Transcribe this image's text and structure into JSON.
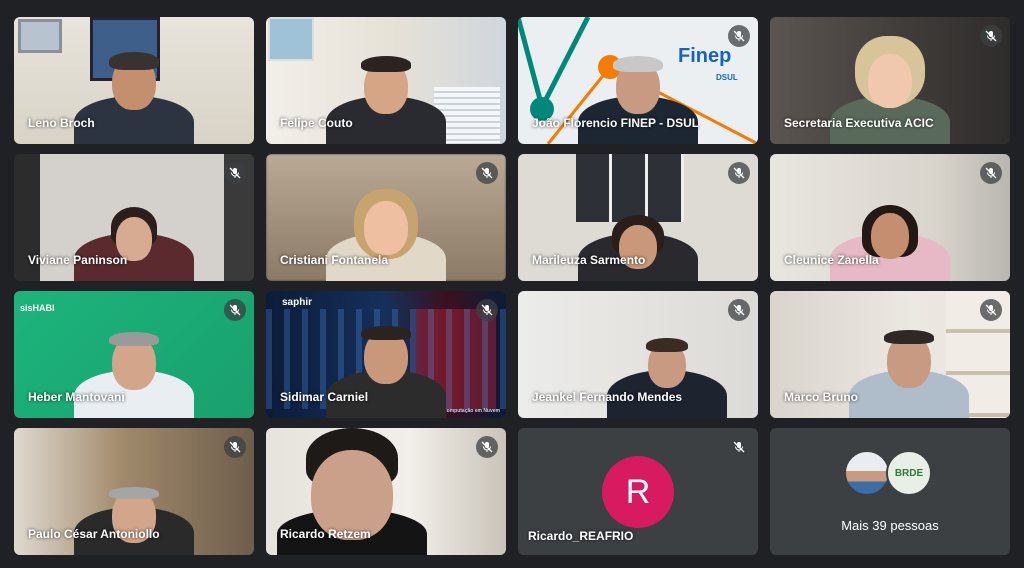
{
  "meeting": {
    "participants": [
      {
        "name": "Leno Broch",
        "muted": false
      },
      {
        "name": "Felipe Couto",
        "muted": false
      },
      {
        "name": "João Florencio FINEP - DSUL",
        "muted": true
      },
      {
        "name": "Secretaria Executiva ACIC",
        "muted": true
      },
      {
        "name": "Viviane Paninson",
        "muted": true
      },
      {
        "name": "Cristiani Fontanela",
        "muted": true
      },
      {
        "name": "Marileuza Sarmento",
        "muted": true
      },
      {
        "name": "Cleunice Zanella",
        "muted": true
      },
      {
        "name": "Heber Mantovani",
        "muted": true
      },
      {
        "name": "Sidimar Carniel",
        "muted": true
      },
      {
        "name": "Jeankel Fernando Mendes",
        "muted": true
      },
      {
        "name": "Marco Bruno",
        "muted": true
      },
      {
        "name": "Paulo César Antoniollo",
        "muted": true
      },
      {
        "name": "Ricardo Retzem",
        "muted": true
      },
      {
        "name": "Ricardo_REAFRIO",
        "muted": true,
        "avatar_letter": "R"
      }
    ],
    "overflow": {
      "label": "Mais 39 pessoas",
      "badge_text": "BRDE"
    },
    "backgrounds": {
      "finep_logo": "Finep",
      "finep_sub": "DSUL",
      "sishabi_logo": "sisHABI",
      "saphir_logo": "saphir",
      "saphir_caption": "Computação em Nuvem"
    },
    "colors": {
      "tile_bg": "#3c4043",
      "page_bg": "#202124",
      "avatar_r": "#d81b60",
      "finep_orange": "#f57c00",
      "finep_teal": "#00897b"
    }
  }
}
